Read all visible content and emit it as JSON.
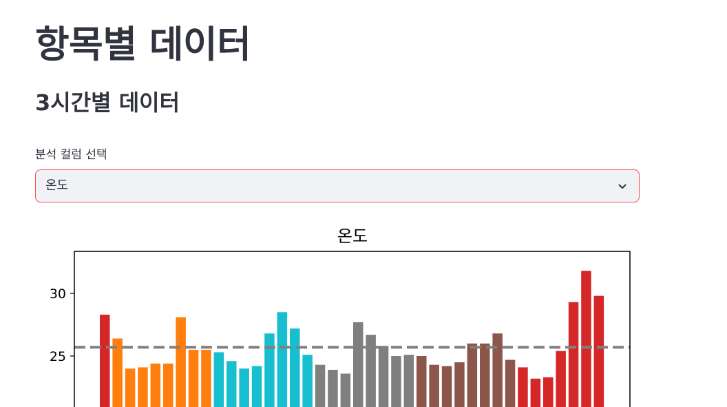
{
  "page_title": "항목별 데이터",
  "section_title": "3시간별 데이터",
  "select": {
    "label": "분석 컬럼 선택",
    "value": "온도",
    "icon": "chevron-down-icon"
  },
  "colors": {
    "accent_border": "#ff4b4b",
    "select_bg": "#f0f2f6",
    "text": "#31333f"
  },
  "chart_data": {
    "type": "bar",
    "title": "온도",
    "xlabel": "",
    "ylabel": "",
    "yticks": [
      25,
      30
    ],
    "ylim": [
      21,
      33.5
    ],
    "values": [
      28.3,
      26.4,
      24.0,
      24.1,
      24.4,
      24.4,
      28.1,
      25.5,
      25.5,
      25.3,
      24.6,
      24.0,
      24.2,
      26.8,
      28.5,
      27.2,
      25.1,
      24.3,
      23.9,
      23.6,
      27.7,
      26.7,
      25.8,
      25.0,
      25.1,
      25.0,
      24.3,
      24.2,
      24.5,
      26.0,
      26.0,
      26.8,
      24.7,
      24.1,
      23.2,
      23.3,
      25.4,
      29.3,
      31.8,
      29.8
    ],
    "colors": [
      "#d62728",
      "#ff7f0e",
      "#ff7f0e",
      "#ff7f0e",
      "#ff7f0e",
      "#ff7f0e",
      "#ff7f0e",
      "#ff7f0e",
      "#ff7f0e",
      "#17becf",
      "#17becf",
      "#17becf",
      "#17becf",
      "#17becf",
      "#17becf",
      "#17becf",
      "#17becf",
      "#7f7f7f",
      "#7f7f7f",
      "#7f7f7f",
      "#7f7f7f",
      "#7f7f7f",
      "#7f7f7f",
      "#7f7f7f",
      "#7f7f7f",
      "#8c564b",
      "#8c564b",
      "#8c564b",
      "#8c564b",
      "#8c564b",
      "#8c564b",
      "#8c564b",
      "#8c564b",
      "#d62728",
      "#d62728",
      "#d62728",
      "#d62728",
      "#d62728",
      "#d62728",
      "#d62728"
    ],
    "mean_line": 25.7,
    "mean_line_color": "#808080",
    "grid": false
  }
}
